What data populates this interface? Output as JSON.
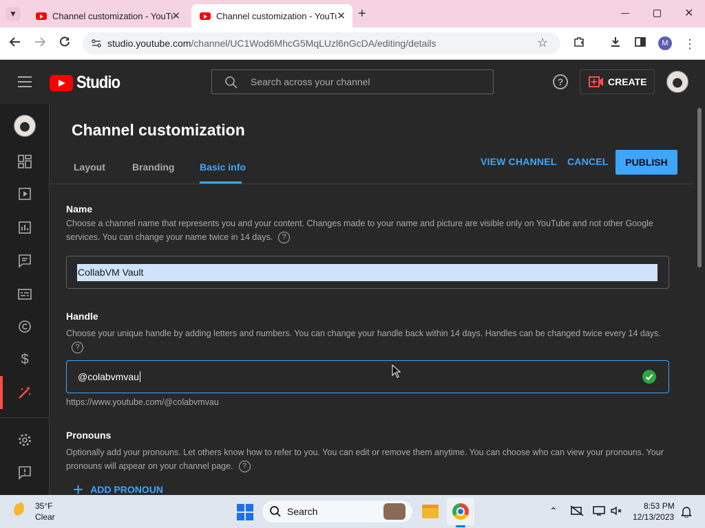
{
  "browser": {
    "tabs": [
      {
        "title": "Channel customization - YouTub",
        "active": false
      },
      {
        "title": "Channel customization - YouTub",
        "active": true
      }
    ],
    "url_host": "studio.youtube.com",
    "url_path": "/channel/UC1Wod6MhcG5MqLUzl6nGcDA/editing/details",
    "profile_initial": "M"
  },
  "studio": {
    "logo_text": "Studio",
    "search_placeholder": "Search across your channel",
    "create_label": "CREATE"
  },
  "page": {
    "title": "Channel customization",
    "tabs": [
      "Layout",
      "Branding",
      "Basic info"
    ],
    "active_tab": "Basic info",
    "view_channel": "VIEW CHANNEL",
    "cancel": "CANCEL",
    "publish": "PUBLISH"
  },
  "name_section": {
    "title": "Name",
    "desc": "Choose a channel name that represents you and your content. Changes made to your name and picture are visible only on YouTube and not other Google services. You can change your name twice in 14 days.",
    "value": "CollabVM Vault"
  },
  "handle_section": {
    "title": "Handle",
    "desc": "Choose your unique handle by adding letters and numbers. You can change your handle back within 14 days. Handles can be changed twice every 14 days.",
    "value": "@colabvmvau",
    "url": "https://www.youtube.com/@colabvmvau"
  },
  "pronouns_section": {
    "title": "Pronouns",
    "desc": "Optionally add your pronouns. Let others know how to refer to you. You can edit or remove them anytime. You can choose who can view your pronouns. Your pronouns will appear on your channel page.",
    "add_label": "ADD PRONOUN"
  },
  "taskbar": {
    "weather_temp": "35°F",
    "weather_desc": "Clear",
    "search_label": "Search",
    "time": "8:53 PM",
    "date": "12/13/2023"
  },
  "colors": {
    "accent": "#3ea6ff",
    "publish_bg": "#3ea6ff",
    "brand_red": "#ff0000",
    "success": "#2ba640"
  }
}
